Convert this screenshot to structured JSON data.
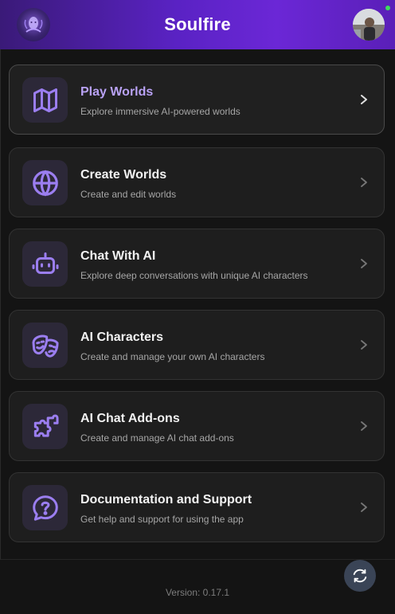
{
  "header": {
    "title": "Soulfire",
    "logo_icon": "soulfire-logo-icon",
    "avatar_icon": "user-avatar",
    "accent": "#6b27d6"
  },
  "menu": {
    "items": [
      {
        "title": "Play Worlds",
        "description": "Explore immersive AI-powered worlds",
        "icon": "map-icon"
      },
      {
        "title": "Create Worlds",
        "description": "Create and edit worlds",
        "icon": "globe-icon"
      },
      {
        "title": "Chat With AI",
        "description": "Explore deep conversations with unique AI characters",
        "icon": "robot-icon"
      },
      {
        "title": "AI Characters",
        "description": "Create and manage your own AI characters",
        "icon": "theater-masks-icon"
      },
      {
        "title": "AI Chat Add-ons",
        "description": "Create and manage AI chat add-ons",
        "icon": "puzzle-icon"
      },
      {
        "title": "Documentation and Support",
        "description": "Get help and support for using the app",
        "icon": "help-bubble-icon"
      }
    ]
  },
  "footer": {
    "version": "Version: 0.17.1",
    "refresh_icon": "refresh-icon"
  },
  "colors": {
    "icon_purple": "#9b7ef0",
    "active_title": "#b9a2f5",
    "card_bg": "#1e1e1e"
  }
}
